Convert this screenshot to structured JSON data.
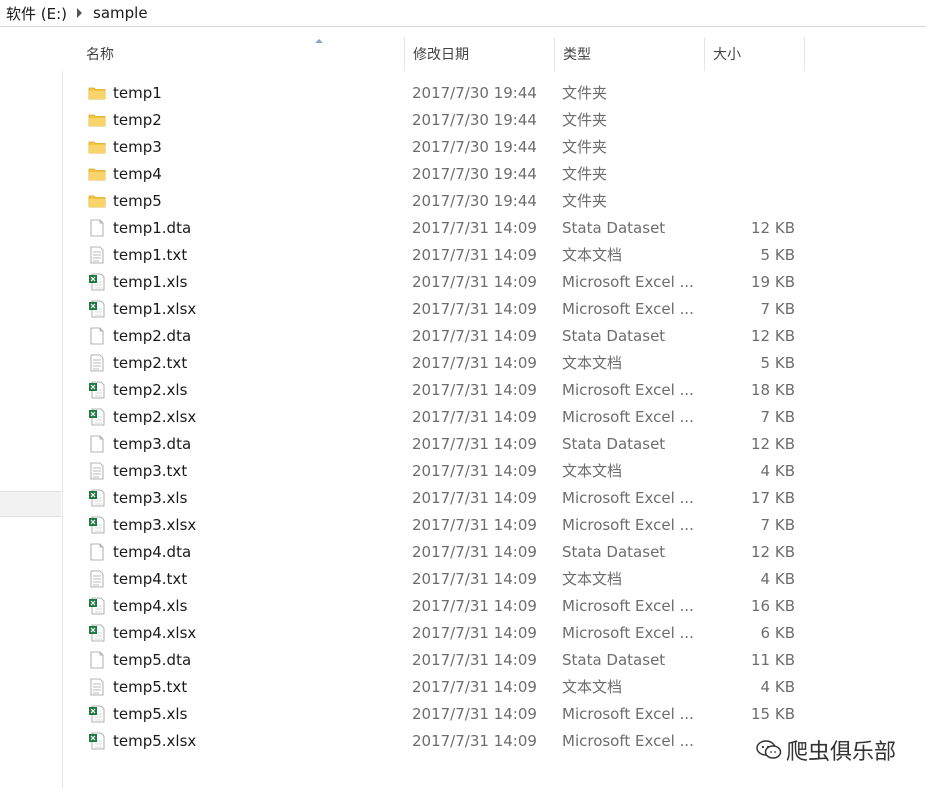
{
  "breadcrumb": {
    "drive": "软件 (E:)",
    "folder": "sample"
  },
  "columns": {
    "name": "名称",
    "date": "修改日期",
    "type": "类型",
    "size": "大小"
  },
  "files": [
    {
      "name": "temp1",
      "date": "2017/7/30 19:44",
      "type": "文件夹",
      "size": "",
      "icon": "folder-icon"
    },
    {
      "name": "temp2",
      "date": "2017/7/30 19:44",
      "type": "文件夹",
      "size": "",
      "icon": "folder-icon"
    },
    {
      "name": "temp3",
      "date": "2017/7/30 19:44",
      "type": "文件夹",
      "size": "",
      "icon": "folder-icon"
    },
    {
      "name": "temp4",
      "date": "2017/7/30 19:44",
      "type": "文件夹",
      "size": "",
      "icon": "folder-icon"
    },
    {
      "name": "temp5",
      "date": "2017/7/30 19:44",
      "type": "文件夹",
      "size": "",
      "icon": "folder-icon"
    },
    {
      "name": "temp1.dta",
      "date": "2017/7/31 14:09",
      "type": "Stata Dataset",
      "size": "12 KB",
      "icon": "blank-file-icon"
    },
    {
      "name": "temp1.txt",
      "date": "2017/7/31 14:09",
      "type": "文本文档",
      "size": "5 KB",
      "icon": "text-file-icon"
    },
    {
      "name": "temp1.xls",
      "date": "2017/7/31 14:09",
      "type": "Microsoft Excel ...",
      "size": "19 KB",
      "icon": "excel-file-icon"
    },
    {
      "name": "temp1.xlsx",
      "date": "2017/7/31 14:09",
      "type": "Microsoft Excel ...",
      "size": "7 KB",
      "icon": "excel-file-icon"
    },
    {
      "name": "temp2.dta",
      "date": "2017/7/31 14:09",
      "type": "Stata Dataset",
      "size": "12 KB",
      "icon": "blank-file-icon"
    },
    {
      "name": "temp2.txt",
      "date": "2017/7/31 14:09",
      "type": "文本文档",
      "size": "5 KB",
      "icon": "text-file-icon"
    },
    {
      "name": "temp2.xls",
      "date": "2017/7/31 14:09",
      "type": "Microsoft Excel ...",
      "size": "18 KB",
      "icon": "excel-file-icon"
    },
    {
      "name": "temp2.xlsx",
      "date": "2017/7/31 14:09",
      "type": "Microsoft Excel ...",
      "size": "7 KB",
      "icon": "excel-file-icon"
    },
    {
      "name": "temp3.dta",
      "date": "2017/7/31 14:09",
      "type": "Stata Dataset",
      "size": "12 KB",
      "icon": "blank-file-icon"
    },
    {
      "name": "temp3.txt",
      "date": "2017/7/31 14:09",
      "type": "文本文档",
      "size": "4 KB",
      "icon": "text-file-icon"
    },
    {
      "name": "temp3.xls",
      "date": "2017/7/31 14:09",
      "type": "Microsoft Excel ...",
      "size": "17 KB",
      "icon": "excel-file-icon"
    },
    {
      "name": "temp3.xlsx",
      "date": "2017/7/31 14:09",
      "type": "Microsoft Excel ...",
      "size": "7 KB",
      "icon": "excel-file-icon"
    },
    {
      "name": "temp4.dta",
      "date": "2017/7/31 14:09",
      "type": "Stata Dataset",
      "size": "12 KB",
      "icon": "blank-file-icon"
    },
    {
      "name": "temp4.txt",
      "date": "2017/7/31 14:09",
      "type": "文本文档",
      "size": "4 KB",
      "icon": "text-file-icon"
    },
    {
      "name": "temp4.xls",
      "date": "2017/7/31 14:09",
      "type": "Microsoft Excel ...",
      "size": "16 KB",
      "icon": "excel-file-icon"
    },
    {
      "name": "temp4.xlsx",
      "date": "2017/7/31 14:09",
      "type": "Microsoft Excel ...",
      "size": "6 KB",
      "icon": "excel-file-icon"
    },
    {
      "name": "temp5.dta",
      "date": "2017/7/31 14:09",
      "type": "Stata Dataset",
      "size": "11 KB",
      "icon": "blank-file-icon"
    },
    {
      "name": "temp5.txt",
      "date": "2017/7/31 14:09",
      "type": "文本文档",
      "size": "4 KB",
      "icon": "text-file-icon"
    },
    {
      "name": "temp5.xls",
      "date": "2017/7/31 14:09",
      "type": "Microsoft Excel ...",
      "size": "15 KB",
      "icon": "excel-file-icon"
    },
    {
      "name": "temp5.xlsx",
      "date": "2017/7/31 14:09",
      "type": "Microsoft Excel ...",
      "size": "",
      "icon": "excel-file-icon"
    }
  ],
  "watermark": {
    "text": "爬虫俱乐部"
  },
  "colors": {
    "folder": "#f4c542",
    "excel": "#1e7a3c",
    "header_text": "#444444",
    "secondary_text": "#6d6d6d"
  }
}
